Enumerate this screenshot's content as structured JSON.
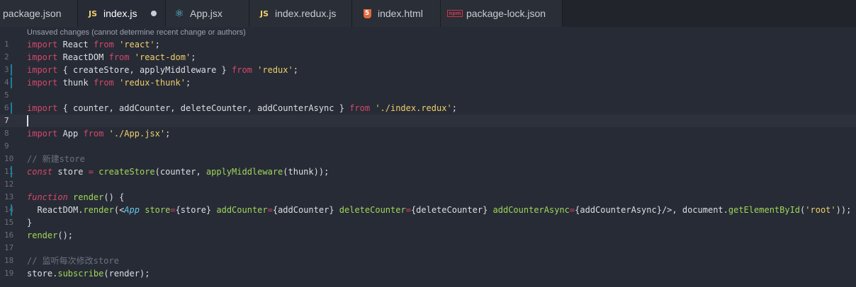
{
  "tabs": [
    {
      "label": "package.json",
      "icon": "json-file-icon",
      "active": false
    },
    {
      "label": "index.js",
      "icon": "js-file-icon",
      "icon_text": "JS",
      "active": true,
      "unsaved": true
    },
    {
      "label": "App.jsx",
      "icon": "react-file-icon",
      "icon_text": "⚛",
      "active": false
    },
    {
      "label": "index.redux.js",
      "icon": "js-file-icon",
      "icon_text": "JS",
      "active": false
    },
    {
      "label": "index.html",
      "icon": "html5-file-icon",
      "icon_text": "5",
      "active": false
    },
    {
      "label": "package-lock.json",
      "icon": "npm-file-icon",
      "icon_text": "npm",
      "active": false
    }
  ],
  "editor": {
    "hint": "Unsaved changes (cannot determine recent change or authors)",
    "current_line": 7,
    "lines": [
      {
        "n": "1",
        "tokens": [
          [
            "kw",
            "import"
          ],
          [
            "pl",
            " React "
          ],
          [
            "kw",
            "from"
          ],
          [
            "pl",
            " "
          ],
          [
            "str",
            "'react'"
          ],
          [
            "pl",
            ";"
          ]
        ]
      },
      {
        "n": "2",
        "tokens": [
          [
            "kw",
            "import"
          ],
          [
            "pl",
            " ReactDOM "
          ],
          [
            "kw",
            "from"
          ],
          [
            "pl",
            " "
          ],
          [
            "str",
            "'react-dom'"
          ],
          [
            "pl",
            ";"
          ]
        ]
      },
      {
        "n": "3",
        "mark": true,
        "tokens": [
          [
            "kw",
            "import"
          ],
          [
            "pl",
            " { createStore, applyMiddleware } "
          ],
          [
            "kw",
            "from"
          ],
          [
            "pl",
            " "
          ],
          [
            "str",
            "'redux'"
          ],
          [
            "pl",
            ";"
          ]
        ]
      },
      {
        "n": "4",
        "mark": true,
        "tokens": [
          [
            "kw",
            "import"
          ],
          [
            "pl",
            " thunk "
          ],
          [
            "kw",
            "from"
          ],
          [
            "pl",
            " "
          ],
          [
            "str",
            "'redux-thunk'"
          ],
          [
            "pl",
            ";"
          ]
        ]
      },
      {
        "n": "5",
        "tokens": []
      },
      {
        "n": "6",
        "mark": true,
        "tokens": [
          [
            "kw",
            "import"
          ],
          [
            "pl",
            " { counter, addCounter, deleteCounter, addCounterAsync } "
          ],
          [
            "kw",
            "from"
          ],
          [
            "pl",
            " "
          ],
          [
            "str",
            "'./index.redux'"
          ],
          [
            "pl",
            ";"
          ]
        ]
      },
      {
        "n": "7",
        "tokens": []
      },
      {
        "n": "8",
        "tokens": [
          [
            "kw",
            "import"
          ],
          [
            "pl",
            " App "
          ],
          [
            "kw",
            "from"
          ],
          [
            "pl",
            " "
          ],
          [
            "str",
            "'./App.jsx'"
          ],
          [
            "pl",
            ";"
          ]
        ]
      },
      {
        "n": "9",
        "tokens": []
      },
      {
        "n": "10",
        "tokens": [
          [
            "cm",
            "// 新建store"
          ]
        ]
      },
      {
        "n": "11",
        "mark": true,
        "tokens": [
          [
            "kwi",
            "const"
          ],
          [
            "pl",
            " store "
          ],
          [
            "kw",
            "="
          ],
          [
            "pl",
            " "
          ],
          [
            "fn",
            "createStore"
          ],
          [
            "pl",
            "(counter, "
          ],
          [
            "fn",
            "applyMiddleware"
          ],
          [
            "pl",
            "(thunk));"
          ]
        ]
      },
      {
        "n": "12",
        "tokens": []
      },
      {
        "n": "13",
        "tokens": [
          [
            "kwi",
            "function"
          ],
          [
            "pl",
            " "
          ],
          [
            "fn",
            "render"
          ],
          [
            "pl",
            "() {"
          ]
        ]
      },
      {
        "n": "14",
        "mark": true,
        "tokens": [
          [
            "pl",
            "  ReactDOM."
          ],
          [
            "fn",
            "render"
          ],
          [
            "pl",
            "(<"
          ],
          [
            "tag",
            "App"
          ],
          [
            "pl",
            " "
          ],
          [
            "attr",
            "store"
          ],
          [
            "kw",
            "="
          ],
          [
            "pl",
            "{store} "
          ],
          [
            "attr",
            "addCounter"
          ],
          [
            "kw",
            "="
          ],
          [
            "pl",
            "{addCounter} "
          ],
          [
            "attr",
            "deleteCounter"
          ],
          [
            "kw",
            "="
          ],
          [
            "pl",
            "{deleteCounter} "
          ],
          [
            "attr",
            "addCounterAsync"
          ],
          [
            "kw",
            "="
          ],
          [
            "pl",
            "{addCounterAsync}/>, document."
          ],
          [
            "fn",
            "getElementById"
          ],
          [
            "pl",
            "("
          ],
          [
            "str",
            "'root'"
          ],
          [
            "pl",
            "));"
          ]
        ]
      },
      {
        "n": "15",
        "tokens": [
          [
            "pl",
            "}"
          ]
        ]
      },
      {
        "n": "16",
        "tokens": [
          [
            "fn",
            "render"
          ],
          [
            "pl",
            "();"
          ]
        ]
      },
      {
        "n": "17",
        "tokens": []
      },
      {
        "n": "18",
        "tokens": [
          [
            "cm",
            "// 监听每次修改store"
          ]
        ]
      },
      {
        "n": "19",
        "tokens": [
          [
            "pl",
            "store."
          ],
          [
            "fn",
            "subscribe"
          ],
          [
            "pl",
            "(render);"
          ]
        ]
      }
    ]
  },
  "colors": {
    "background": "#272b35",
    "keyword": "#d4486b",
    "string": "#f0cf6b",
    "function": "#9fd65b",
    "comment": "#6b7280",
    "jsx_tag": "#64c8e8",
    "git_mark": "#1d7d9b"
  }
}
